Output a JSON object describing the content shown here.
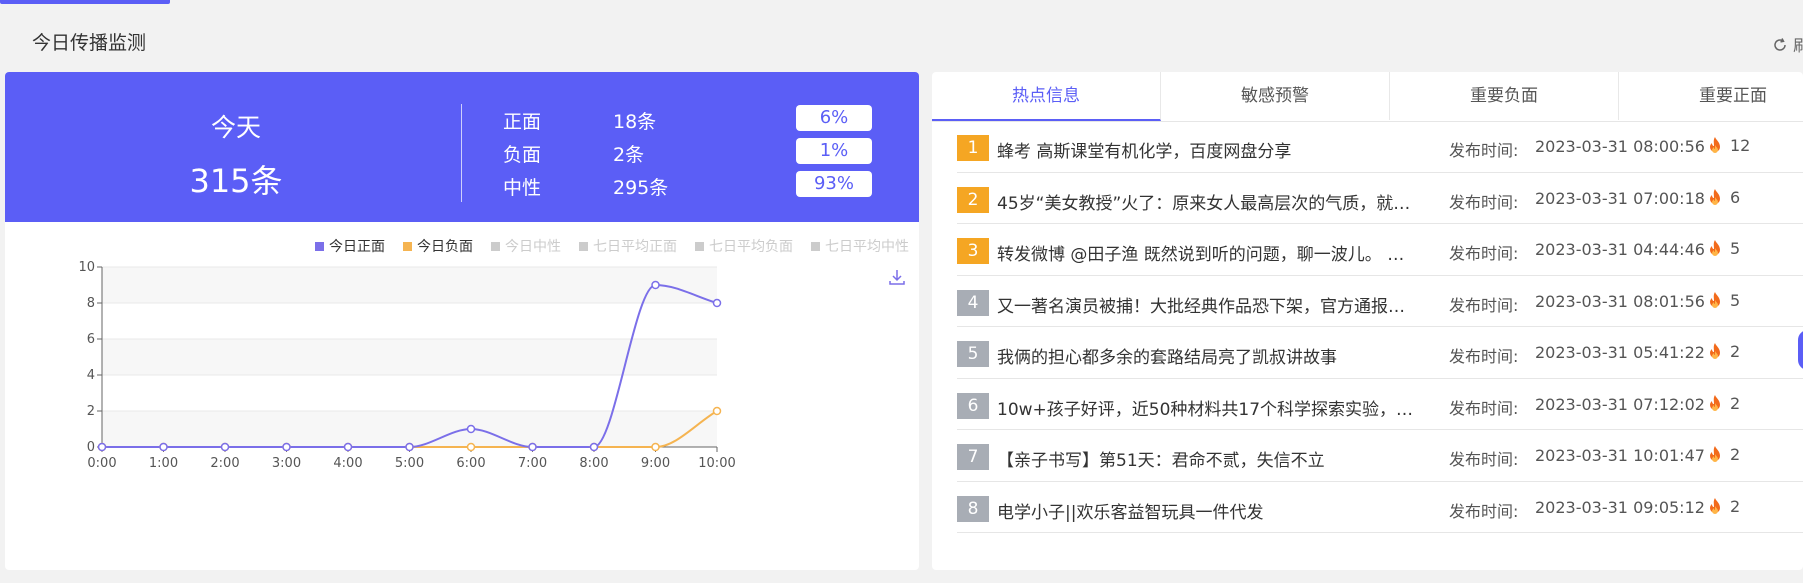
{
  "header": {
    "title": "今日传播监测",
    "refresh_label": "刷"
  },
  "summary": {
    "today_label": "今天",
    "today_count": "315条",
    "rows": [
      {
        "label": "正面",
        "count": "18条",
        "percent": "6%"
      },
      {
        "label": "负面",
        "count": "2条",
        "percent": "1%"
      },
      {
        "label": "中性",
        "count": "295条",
        "percent": "93%"
      }
    ]
  },
  "legend": [
    {
      "label": "今日正面",
      "active": true,
      "color": "#7b6fe9"
    },
    {
      "label": "今日负面",
      "active": true,
      "color": "#f5b451"
    },
    {
      "label": "今日中性",
      "active": false,
      "color": "#cccccc"
    },
    {
      "label": "七日平均正面",
      "active": false,
      "color": "#cccccc"
    },
    {
      "label": "七日平均负面",
      "active": false,
      "color": "#cccccc"
    },
    {
      "label": "七日平均中性",
      "active": false,
      "color": "#cccccc"
    }
  ],
  "chart_data": {
    "type": "line",
    "x": [
      "0:00",
      "1:00",
      "2:00",
      "3:00",
      "4:00",
      "5:00",
      "6:00",
      "7:00",
      "8:00",
      "9:00",
      "10:00"
    ],
    "yticks": [
      0,
      2,
      4,
      6,
      8,
      10
    ],
    "ylim": [
      0,
      10
    ],
    "series": [
      {
        "name": "今日正面",
        "color": "#7b6fe9",
        "values": [
          0,
          0,
          0,
          0,
          0,
          0,
          1,
          0,
          0,
          9,
          8
        ]
      },
      {
        "name": "今日负面",
        "color": "#f5b451",
        "values": [
          0,
          0,
          0,
          0,
          0,
          0,
          0,
          0,
          0,
          0,
          2
        ]
      }
    ]
  },
  "tabs": [
    {
      "label": "热点信息",
      "active": true
    },
    {
      "label": "敏感预警",
      "active": false
    },
    {
      "label": "重要负面",
      "active": false
    },
    {
      "label": "重要正面",
      "active": false
    }
  ],
  "news": [
    {
      "rank": "1",
      "title": "蜂考 高斯课堂有机化学，百度网盘分享",
      "time_label": "发布时间:",
      "time": "2023-03-31 08:00:56",
      "heat": "12"
    },
    {
      "rank": "2",
      "title": "45岁“美女教授”火了：原来女人最高层次的气质，就是…",
      "time_label": "发布时间:",
      "time": "2023-03-31 07:00:18",
      "heat": "6"
    },
    {
      "rank": "3",
      "title": "转发微博 @田子渔 既然说到听的问题，聊一波儿。 …",
      "time_label": "发布时间:",
      "time": "2023-03-31 04:44:46",
      "heat": "5"
    },
    {
      "rank": "4",
      "title": "又一著名演员被捕！大批经典作品恐下架，官方通报…",
      "time_label": "发布时间:",
      "time": "2023-03-31 08:01:56",
      "heat": "5"
    },
    {
      "rank": "5",
      "title": "我俩的担心都多余的套路结局亮了凯叔讲故事",
      "time_label": "发布时间:",
      "time": "2023-03-31 05:41:22",
      "heat": "2"
    },
    {
      "rank": "6",
      "title": "10w+孩子好评，近50种材料共17个科学探索实验，…",
      "time_label": "发布时间:",
      "time": "2023-03-31 07:12:02",
      "heat": "2"
    },
    {
      "rank": "7",
      "title": "【亲子书写】第51天：君命不贰，失信不立",
      "time_label": "发布时间:",
      "time": "2023-03-31 10:01:47",
      "heat": "2"
    },
    {
      "rank": "8",
      "title": "电学小子||欢乐客益智玩具一件代发",
      "time_label": "发布时间:",
      "time": "2023-03-31 09:05:12",
      "heat": "2"
    }
  ]
}
